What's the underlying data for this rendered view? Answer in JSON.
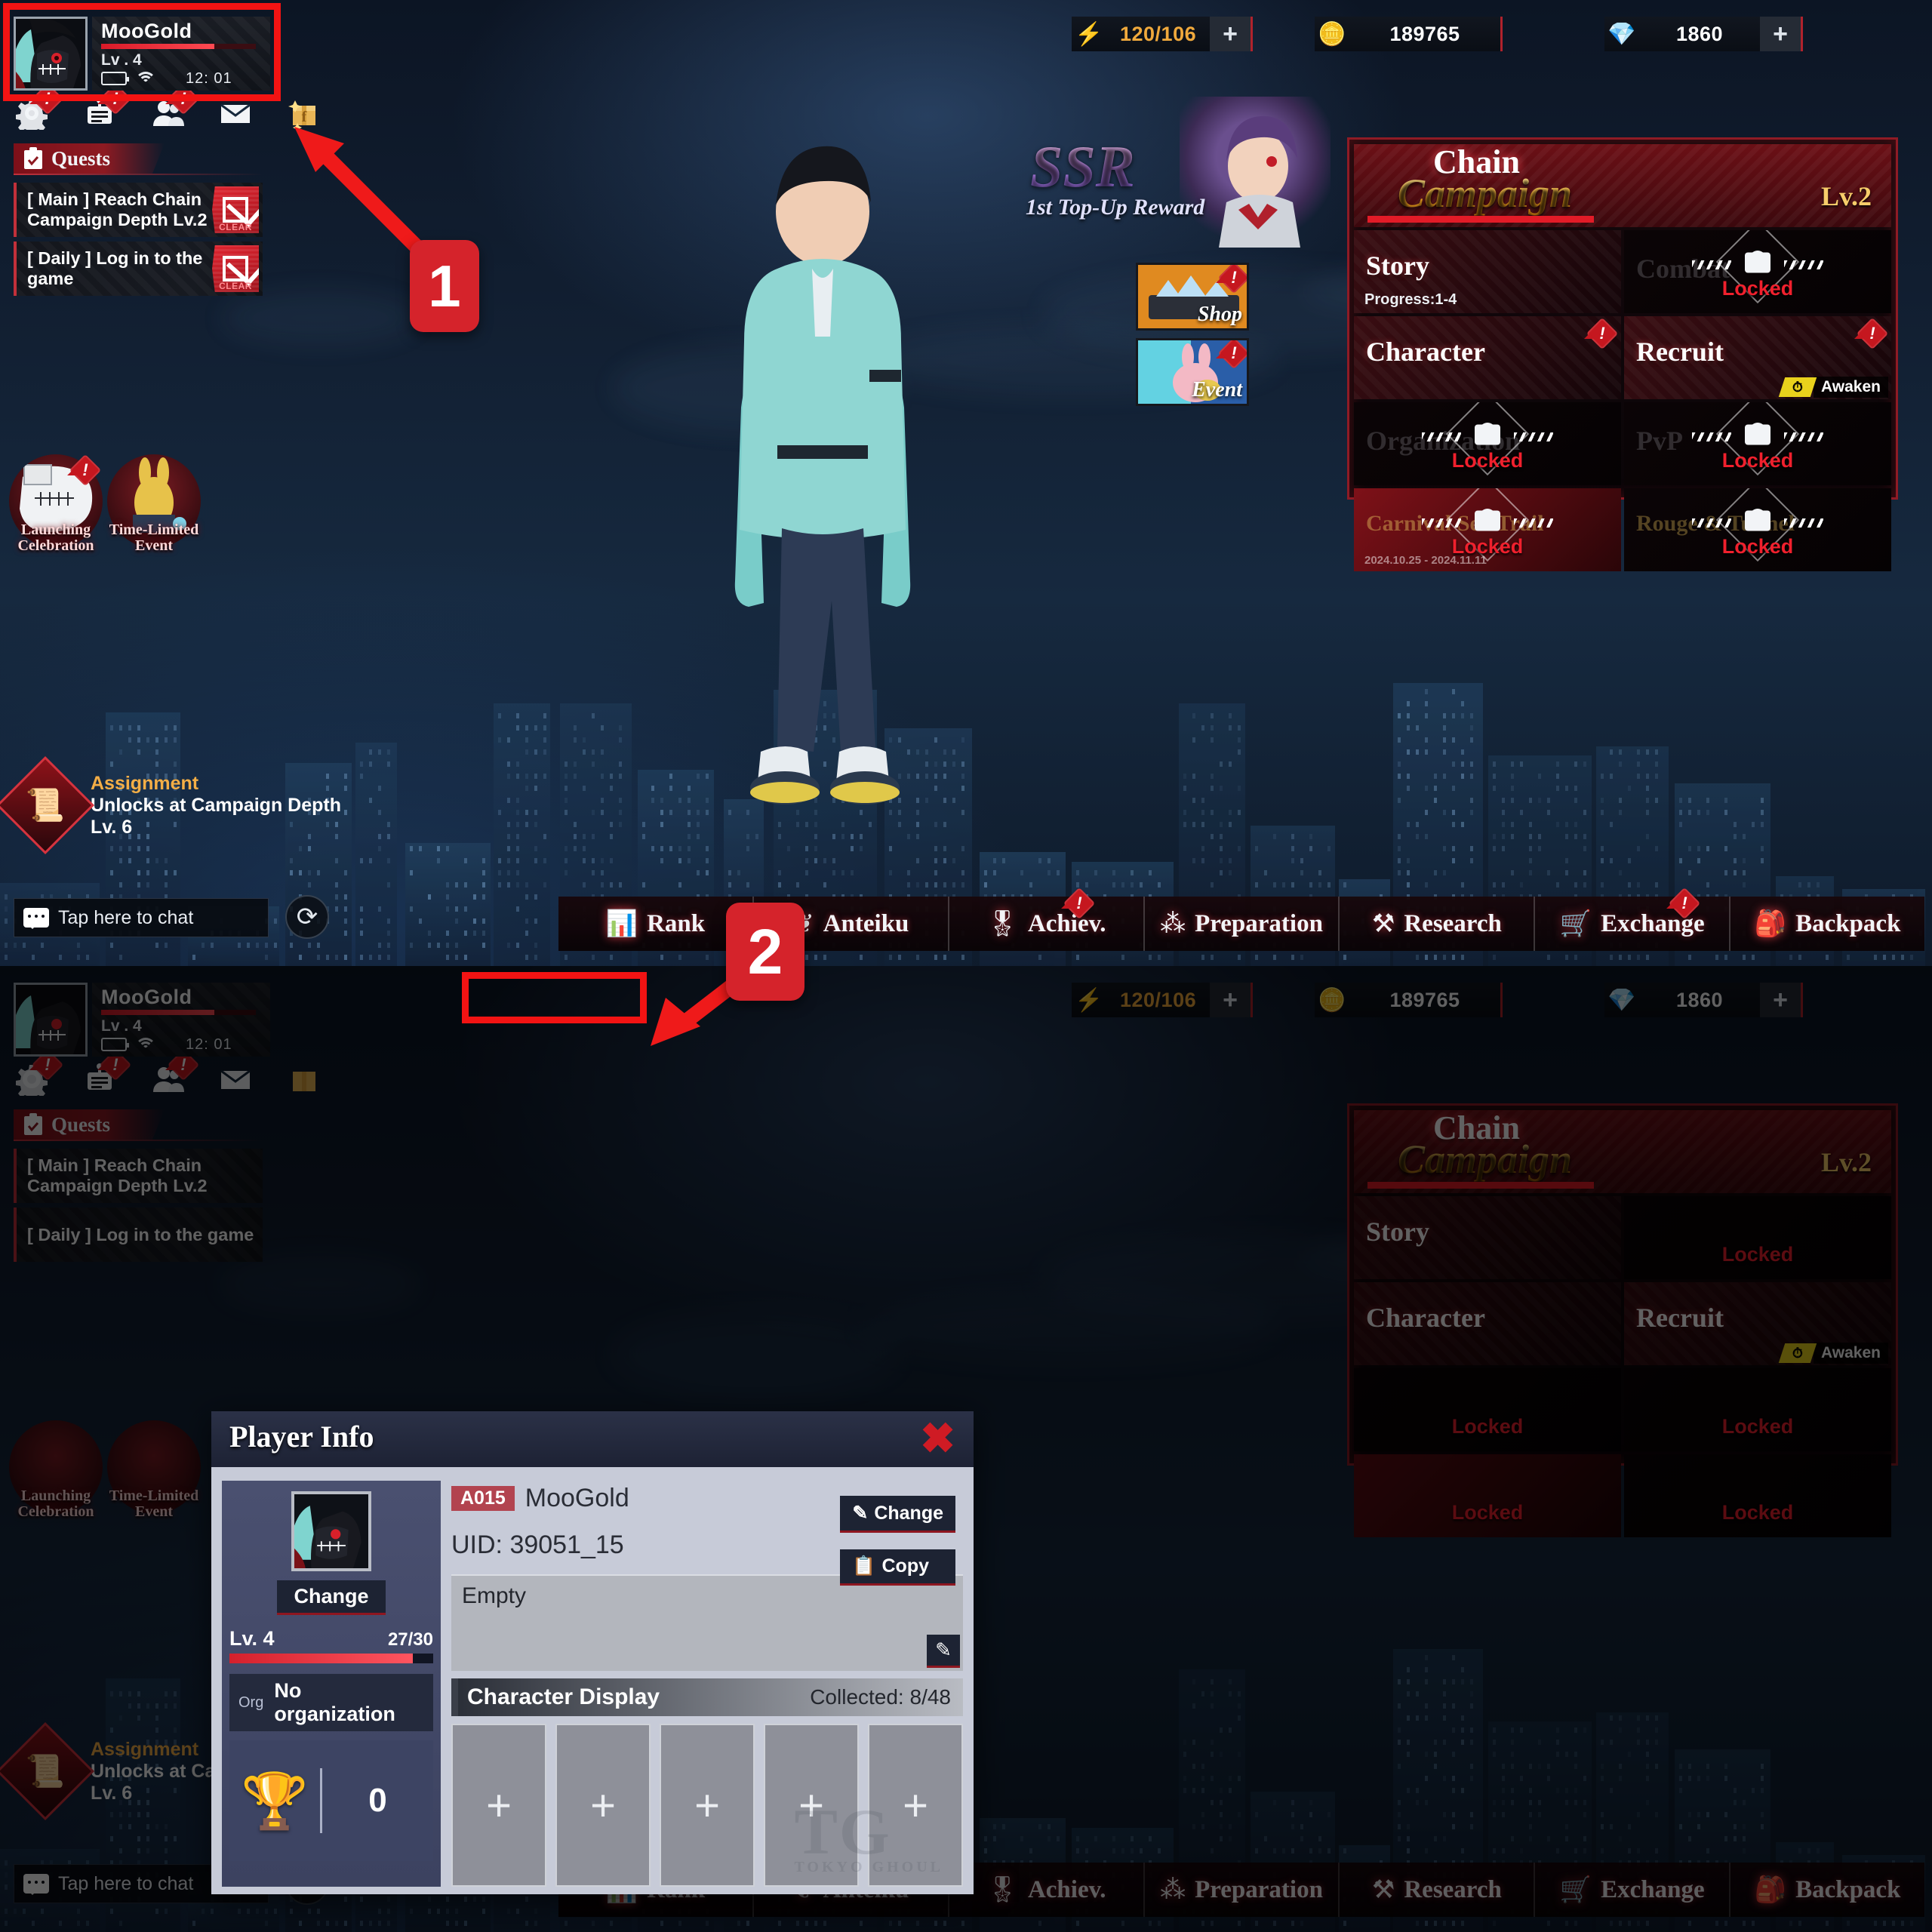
{
  "player": {
    "name": "MooGold",
    "level_label": "Lv . 4",
    "time": "12: 01",
    "battery_icon": "battery-icon",
    "wifi_icon": "wifi-icon"
  },
  "resources": [
    {
      "icon": "stamina-bolt-icon",
      "value": "120/106",
      "plus": "+",
      "color": "#f0a93c"
    },
    {
      "icon": "gold-coin-icon",
      "value": "189765",
      "plus": "",
      "color": "#ffffff"
    },
    {
      "icon": "diamond-gem-icon",
      "value": "1860",
      "plus": "+",
      "color": "#ffffff"
    }
  ],
  "icon_row": [
    {
      "name": "settings-gear-icon",
      "glyph": "⚙",
      "badge": "!"
    },
    {
      "name": "notice-board-icon",
      "glyph": "ὌB",
      "badge": "!"
    },
    {
      "name": "friends-icon",
      "glyph": "὆5",
      "badge": "!"
    },
    {
      "name": "mail-envelope-icon",
      "glyph": "✉",
      "badge": ""
    },
    {
      "name": "facebook-gift-icon",
      "glyph": "f",
      "badge": ""
    }
  ],
  "quests": {
    "header": "Quests",
    "items": [
      {
        "text": "[ Main ]   Reach Chain Campaign Depth Lv.2",
        "state": "CLEAR"
      },
      {
        "text": "[ Daily ]   Log in to the game",
        "state": "CLEAR"
      }
    ]
  },
  "events": [
    {
      "label": "Launching Celebration",
      "badge": "!"
    },
    {
      "label": "Time-Limited Event",
      "badge": ""
    }
  ],
  "assignment": {
    "title": "Assignment",
    "desc": "Unlocks at Campaign Depth Lv. 6"
  },
  "chat": {
    "placeholder": "Tap here to chat",
    "icon": "chat-bubble-icon",
    "refresh_icon": "refresh-icon"
  },
  "ssr_banner": {
    "title": "SSR",
    "subtitle": "1st Top-Up Reward"
  },
  "side_buttons": [
    {
      "label": "Shop",
      "badge": "!"
    },
    {
      "label": "Event",
      "badge": "!"
    }
  ],
  "chain_campaign": {
    "title_line1": "Chain",
    "title_line2": "Campaign",
    "level": "Lv.2",
    "cells": [
      {
        "label": "Story",
        "progress": "Progress:1-4",
        "locked": false,
        "badge": ""
      },
      {
        "label": "Combat",
        "progress": "",
        "locked": true,
        "locked_text": "Locked",
        "badge": ""
      },
      {
        "label": "Character",
        "progress": "",
        "locked": false,
        "badge": "!"
      },
      {
        "label": "Recruit",
        "progress": "",
        "locked": false,
        "badge": "!",
        "awaken": "Awaken"
      },
      {
        "label": "Organization",
        "progress": "",
        "locked": true,
        "locked_text": "Locked",
        "badge": ""
      },
      {
        "label": "PvP",
        "progress": "",
        "locked": true,
        "locked_text": "Locked",
        "badge": ""
      },
      {
        "label": "Carnival Sea Trail",
        "progress": "2024.10.25 - 2024.11.11",
        "locked": true,
        "locked_text": "Locked",
        "badge": ""
      },
      {
        "label": "Rouge & Tunnel",
        "progress": "",
        "locked": true,
        "locked_text": "Locked",
        "badge": ""
      }
    ]
  },
  "bottom_nav": [
    {
      "label": "Rank",
      "icon": "bar-chart-icon",
      "glyph": "ὌA",
      "badge": ""
    },
    {
      "label": "Anteiku",
      "icon": "coffee-beans-icon",
      "glyph": "❦",
      "badge": ""
    },
    {
      "label": "Achiev.",
      "icon": "medal-icon",
      "glyph": "Ἱ6",
      "badge": "!"
    },
    {
      "label": "Preparation",
      "icon": "molecule-icon",
      "glyph": "⁂",
      "badge": ""
    },
    {
      "label": "Research",
      "icon": "tools-icon",
      "glyph": "⚒",
      "badge": ""
    },
    {
      "label": "Exchange",
      "icon": "shopping-cart-icon",
      "glyph": "Ὥ2",
      "badge": "!"
    },
    {
      "label": "Backpack",
      "icon": "backpack-icon",
      "glyph": "Ἱ2",
      "badge": ""
    }
  ],
  "dialog": {
    "title": "Player Info",
    "close_icon": "close-x-icon",
    "tag": "A015",
    "name": "MooGold",
    "uid": "UID: 39051_15",
    "change_button": "Change",
    "copy_button": "Copy",
    "avatar_change_button": "Change",
    "level_label": "Lv. 4",
    "level_progress": "27/30",
    "org_key": "Org",
    "org_value": "No organization",
    "trophy_count": "0",
    "signature_placeholder": "Empty",
    "signature_edit_icon": "pencil-edit-icon",
    "character_display_title": "Character Display",
    "collected": "Collected: 8/48",
    "slots": [
      "+",
      "+",
      "+",
      "+",
      "+"
    ],
    "watermark": "TG",
    "watermark_sub": "TOKYO  GHOUL"
  },
  "annotations": [
    {
      "name": "step-marker-1",
      "label": "1"
    },
    {
      "name": "step-marker-2",
      "label": "2"
    }
  ],
  "colors": {
    "accent_red": "#d5232b",
    "highlight_red": "#f21313",
    "gold": "#f0a93c",
    "locked_red": "#f0202d"
  }
}
